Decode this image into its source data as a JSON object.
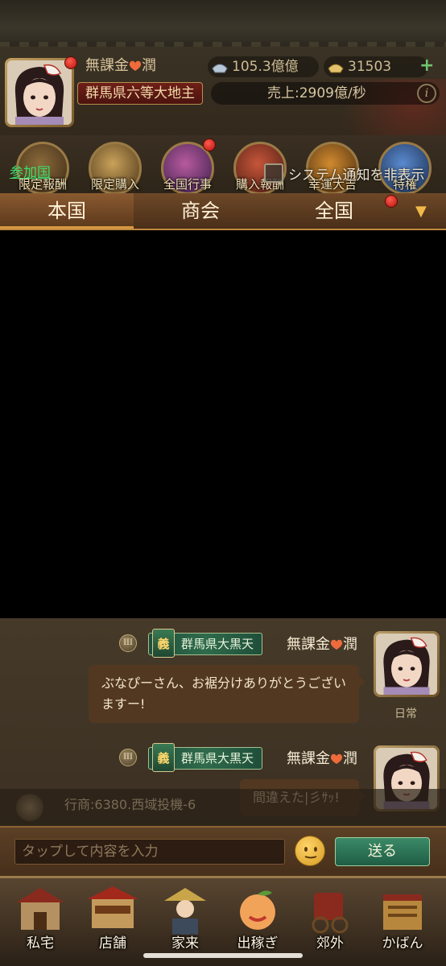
{
  "header": {
    "player_name": "無課金",
    "player_name_suffix": "潤",
    "title": "群馬県六等大地主",
    "silver": "105.3億億",
    "gold": "31503",
    "sales": "売上:2909億/秒"
  },
  "events": [
    {
      "label": "限定報酬"
    },
    {
      "label": "限定購入"
    },
    {
      "label": "全国行事"
    },
    {
      "label": "購入報酬"
    },
    {
      "label": "幸運大吉"
    },
    {
      "label": "特権"
    }
  ],
  "join_link": "参加国",
  "system_notice": "システム通知を非表示",
  "tabs": [
    {
      "label": "本国"
    },
    {
      "label": "商会"
    },
    {
      "label": "全国"
    }
  ],
  "messages": [
    {
      "rank": "III",
      "guild_emblem": "義",
      "guild": "群馬県大黒天",
      "name": "無課金",
      "name_suffix": "潤",
      "text": "ぶなぴーさん、お裾分けありがとうございますー!",
      "badge": "日常"
    },
    {
      "rank": "III",
      "guild_emblem": "義",
      "guild": "群馬県大黒天",
      "name": "無課金",
      "name_suffix": "潤",
      "text": "間違えた|彡ｻｯ!"
    }
  ],
  "trade_line": "行商:6380.西域投機-6",
  "input": {
    "placeholder": "タップして内容を入力"
  },
  "send_label": "送る",
  "nav": [
    {
      "label": "私宅"
    },
    {
      "label": "店舗"
    },
    {
      "label": "家来"
    },
    {
      "label": "出稼ぎ"
    },
    {
      "label": "郊外"
    },
    {
      "label": "かばん"
    }
  ],
  "colors": {
    "accent_gold": "#c08a3f",
    "link_green": "#3fdc6b",
    "guild_green": "#2f6b4c",
    "notification_red": "#e0261b"
  }
}
